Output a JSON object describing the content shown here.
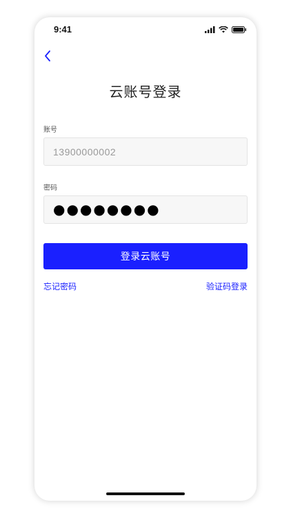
{
  "status_bar": {
    "time": "9:41",
    "icons": [
      "signal-icon",
      "wifi-icon",
      "battery-icon"
    ]
  },
  "header": {
    "back_icon": "chevron-left-icon",
    "title": "云账号登录"
  },
  "form": {
    "account_label": "账号",
    "account_value": "13900000002",
    "password_label": "密码",
    "password_mask": "●●●●●●●●"
  },
  "actions": {
    "login_label": "登录云账号",
    "forgot_label": "忘记密码",
    "sms_login_label": "验证码登录"
  },
  "colors": {
    "accent": "#1a20ff",
    "field_bg": "#f7f7f7"
  }
}
